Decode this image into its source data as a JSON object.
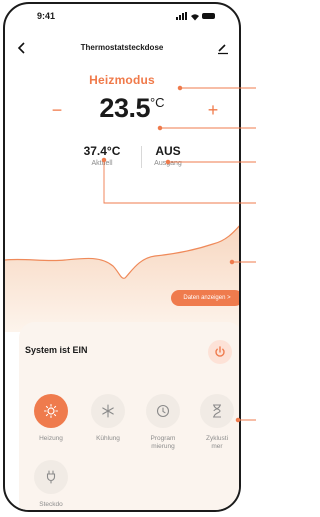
{
  "status_bar": {
    "time": "9:41"
  },
  "header": {
    "title": "Thermostatsteckdose"
  },
  "mode_label": "Heizmodus",
  "setpoint": {
    "value": "23.5",
    "unit": "°C"
  },
  "readouts": [
    {
      "value": "37.4°C",
      "label": "Aktuell"
    },
    {
      "value": "AUS",
      "label": "Ausgang"
    }
  ],
  "chart": {
    "button_label": "Daten anzeigen >"
  },
  "control_panel": {
    "system_status": "System ist EIN",
    "modes": [
      {
        "label_line1": "Heizung",
        "label_line2": "",
        "icon": "sun-icon",
        "active": true
      },
      {
        "label_line1": "Kühlung",
        "label_line2": "",
        "icon": "snowflake-icon",
        "active": false
      },
      {
        "label_line1": "Program",
        "label_line2": "mierung",
        "icon": "clock-icon",
        "active": false
      },
      {
        "label_line1": "Zyklusti",
        "label_line2": "mer",
        "icon": "hourglass-icon",
        "active": false
      },
      {
        "label_line1": "Steckdo",
        "label_line2": "",
        "icon": "plug-icon",
        "active": false
      }
    ]
  },
  "colors": {
    "accent": "#ef7b4d",
    "accent_soft": "#fde2d7",
    "panel_bg": "#fbf4ee"
  }
}
